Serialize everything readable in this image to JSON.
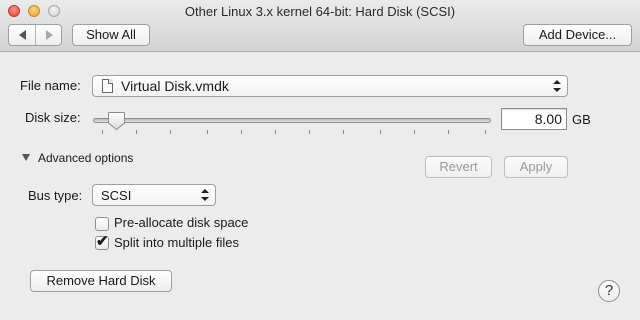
{
  "window": {
    "title": "Other Linux 3.x kernel 64-bit: Hard Disk (SCSI)"
  },
  "toolbar": {
    "show_all_label": "Show All",
    "add_device_label": "Add Device..."
  },
  "file": {
    "label": "File name:",
    "value": "Virtual Disk.vmdk"
  },
  "disk_size": {
    "label": "Disk size:",
    "value": "8.00",
    "unit": "GB",
    "slider_fraction": 0.04
  },
  "advanced": {
    "label": "Advanced options",
    "expanded": true,
    "revert_label": "Revert",
    "apply_label": "Apply"
  },
  "bus": {
    "label": "Bus type:",
    "value": "SCSI"
  },
  "options": [
    {
      "label": "Pre-allocate disk space",
      "checked": false
    },
    {
      "label": "Split into multiple files",
      "checked": true
    }
  ],
  "remove_label": "Remove Hard Disk",
  "help_label": "?",
  "icons": {
    "back": "chevron-left-icon",
    "forward": "chevron-right-icon",
    "file": "document-icon",
    "popup": "up-down-arrows-icon",
    "disclosure": "triangle-down-icon",
    "check": "checkmark-icon"
  }
}
